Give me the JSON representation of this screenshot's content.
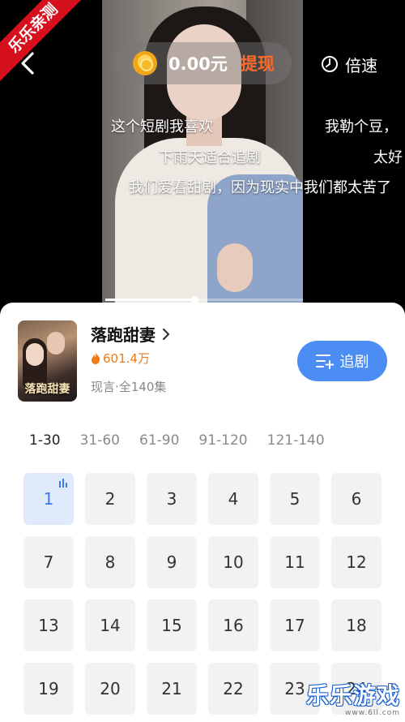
{
  "ribbon": {
    "text": "乐乐亲测"
  },
  "top_bar": {
    "back_icon": "chevron-left-icon",
    "coin_icon": "gold-coin-icon",
    "coin_amount": "0.00元",
    "withdraw_label": "提现",
    "speed_icon": "timer-icon",
    "speed_label": "倍速"
  },
  "danmaku": [
    "这个短剧我喜欢",
    "我勒个豆，",
    "下雨天适合追剧",
    "太好",
    "我们爱看甜剧，因为现实中我们都太苦了"
  ],
  "player": {
    "progress": 0.45
  },
  "drama": {
    "title": "落跑甜妻",
    "poster_title": "落跑甜妻",
    "heat": "601.4万",
    "meta": "现言·全140集",
    "follow_label": "追剧"
  },
  "range_tabs": [
    "1-30",
    "31-60",
    "61-90",
    "91-120",
    "121-140"
  ],
  "active_range": "1-30",
  "current_episode": "1",
  "episodes": [
    "1",
    "2",
    "3",
    "4",
    "5",
    "6",
    "7",
    "8",
    "9",
    "10",
    "11",
    "12",
    "13",
    "14",
    "15",
    "16",
    "17",
    "18",
    "19",
    "20",
    "21",
    "22",
    "23",
    "24"
  ],
  "watermark": {
    "main": "乐乐游戏",
    "url": "www.6ll.com"
  },
  "colors": {
    "accent": "#4c8df3",
    "withdraw": "#ff6a2b",
    "heat": "#f07a18",
    "ribbon": "#d6101d"
  }
}
